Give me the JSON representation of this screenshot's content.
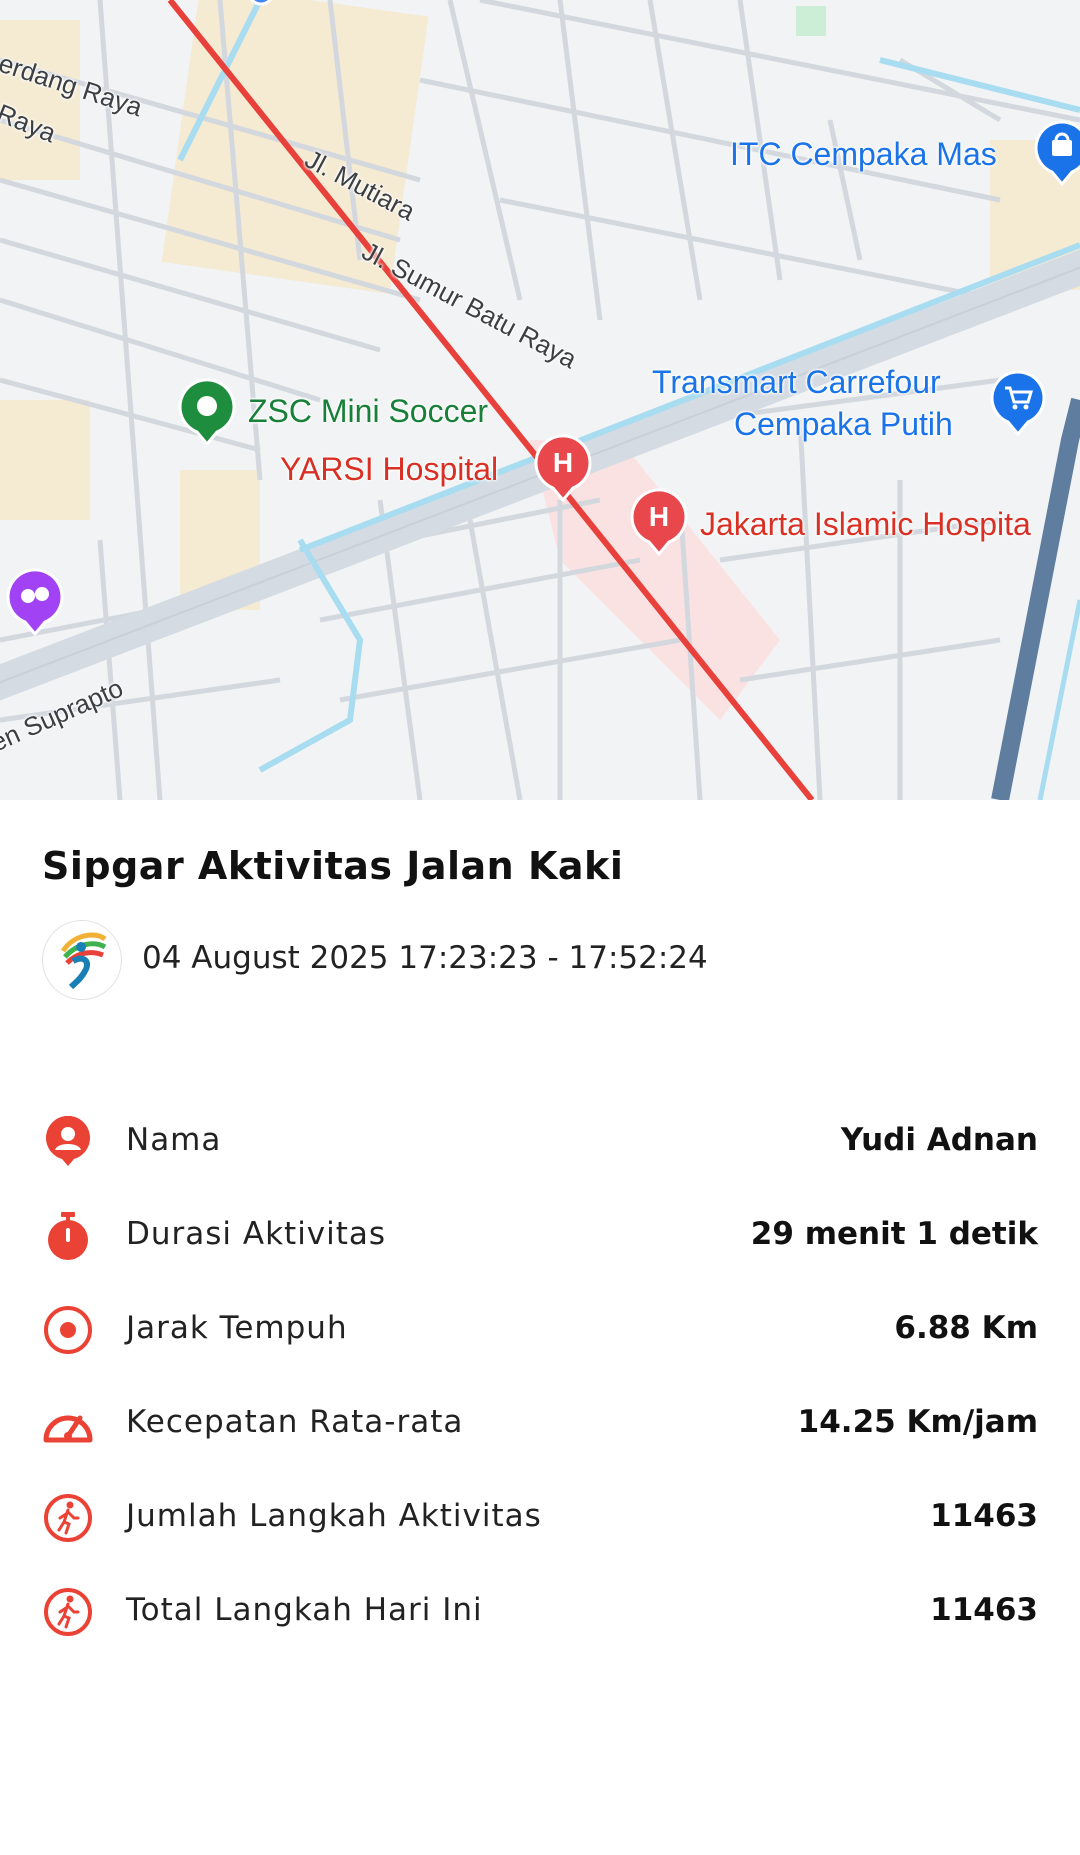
{
  "map": {
    "streets": [
      "erdang Raya",
      "Raya",
      "Jl. Mutiara",
      "Jl. Sumur Batu Raya",
      "en Suprapto"
    ],
    "pois": {
      "itc": "ITC Cempaka Mas",
      "transmart_line1": "Transmart Carrefour",
      "transmart_line2": "Cempaka Putih",
      "zsc": "ZSC Mini Soccer",
      "yarsi": "YARSI Hospital",
      "jakarta_islamic": "Jakarta Islamic Hospita"
    },
    "route_color": "#e8403a"
  },
  "activity": {
    "title": "Sipgar Aktivitas Jalan Kaki",
    "datetime": "04 August 2025 17:23:23 - 17:52:24",
    "rows": [
      {
        "icon": "person-pin-icon",
        "label": "Nama",
        "value": "Yudi Adnan"
      },
      {
        "icon": "stopwatch-icon",
        "label": "Durasi Aktivitas",
        "value": "29 menit 1 detik"
      },
      {
        "icon": "target-icon",
        "label": "Jarak Tempuh",
        "value": "6.88 Km"
      },
      {
        "icon": "speedometer-icon",
        "label": "Kecepatan Rata-rata",
        "value": "14.25 Km/jam"
      },
      {
        "icon": "walking-icon",
        "label": "Jumlah Langkah Aktivitas",
        "value": "11463"
      },
      {
        "icon": "walking-icon",
        "label": "Total Langkah Hari Ini",
        "value": "11463"
      }
    ],
    "accent_color": "#ea4335"
  }
}
